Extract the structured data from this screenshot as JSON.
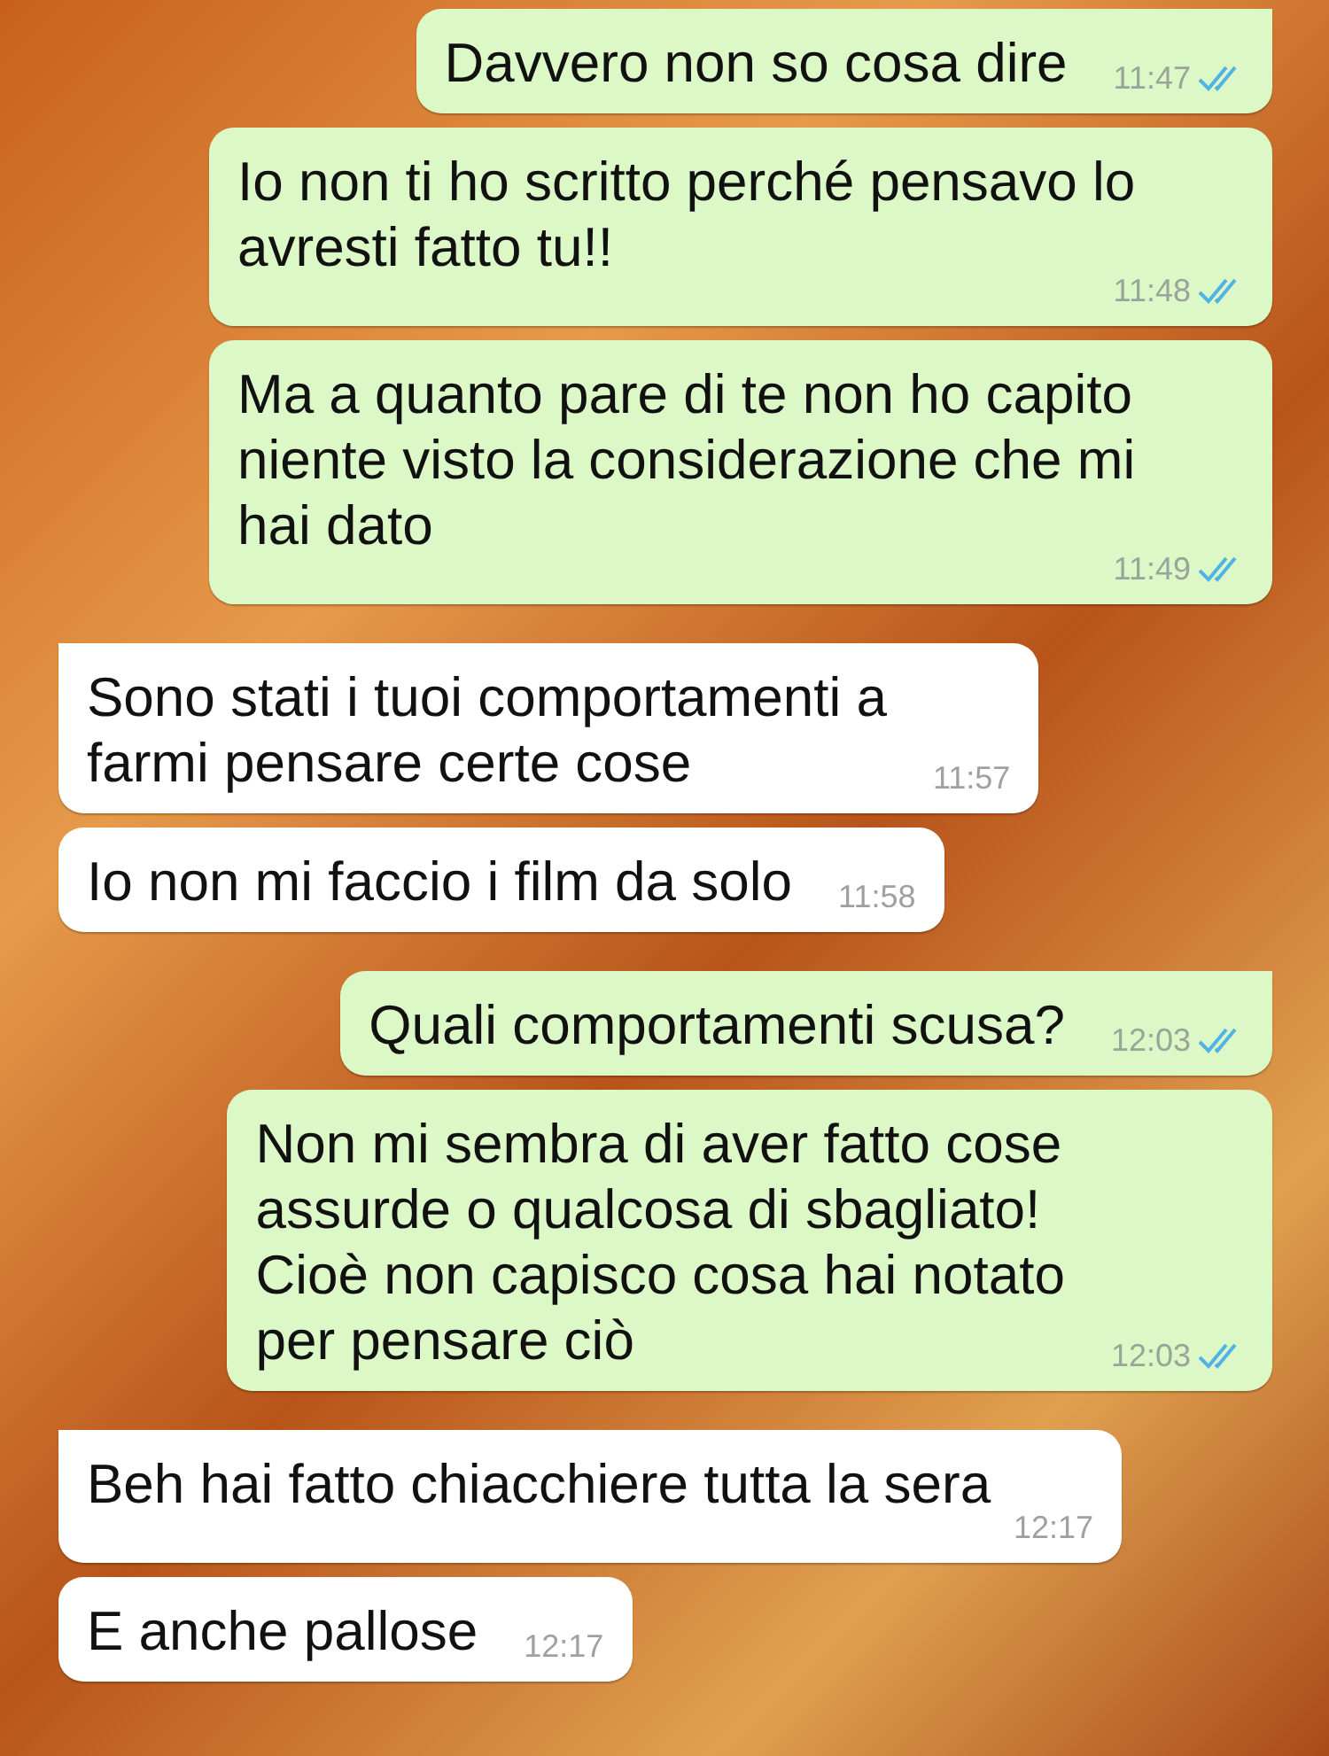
{
  "messages": [
    {
      "kind": "outgoing",
      "text": "Davvero non so cosa dire",
      "time": "11:47",
      "read": true,
      "group_start": true
    },
    {
      "kind": "outgoing",
      "text": "Io non ti ho scritto perché pensavo lo\navresti fatto tu!!",
      "time": "11:48",
      "read": true,
      "group_start": false
    },
    {
      "kind": "outgoing",
      "text": "Ma a quanto pare di te non ho capito\nniente visto la considerazione che mi\nhai dato",
      "time": "11:49",
      "read": true,
      "group_start": false
    },
    {
      "kind": "incoming",
      "text": "Sono stati i tuoi comportamenti a\nfarmi pensare certe cose",
      "time": "11:57",
      "group_start": true
    },
    {
      "kind": "incoming",
      "text": "Io non mi faccio i film da solo",
      "time": "11:58",
      "group_start": false
    },
    {
      "kind": "outgoing",
      "text": "Quali comportamenti scusa?",
      "time": "12:03",
      "read": true,
      "group_start": true
    },
    {
      "kind": "outgoing",
      "text": "Non mi sembra di aver fatto cose\nassurde o qualcosa di sbagliato!\nCioè non capisco cosa hai notato\nper pensare ciò",
      "time": "12:03",
      "read": true,
      "group_start": false
    },
    {
      "kind": "incoming",
      "text": "Beh hai fatto chiacchiere tutta la sera",
      "time": "12:17",
      "group_start": true
    },
    {
      "kind": "incoming",
      "text": "E anche pallose",
      "time": "12:17",
      "group_start": false
    }
  ]
}
